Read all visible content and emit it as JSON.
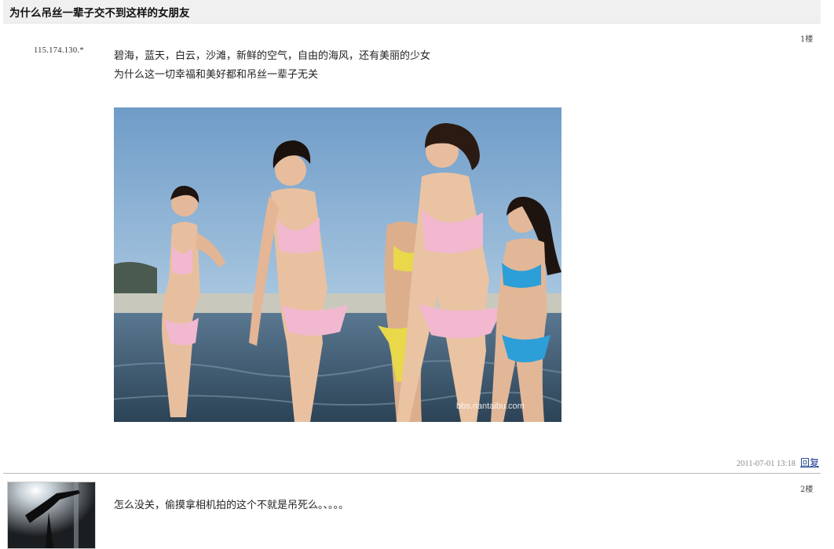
{
  "thread": {
    "title": "为什么吊丝一辈子交不到这样的女朋友"
  },
  "posts": [
    {
      "floor": "1楼",
      "author_ip": "115.174.130.*",
      "lines": [
        "碧海，蓝天，白云，沙滩，新鲜的空气，自由的海风，还有美丽的少女",
        "为什么这一切幸福和美好都和吊丝一辈子无关"
      ],
      "image": {
        "watermark": "bbs.nantaibu.com",
        "sky_color": "#7ea9cf",
        "sea_color": "#42627c",
        "bikini_colors": [
          "#f2b8cf",
          "#e8d84a",
          "#2d9fd8"
        ]
      },
      "timestamp": "2011-07-01 13:18",
      "reply_label": "回复"
    },
    {
      "floor": "2楼",
      "text": "怎么没关，偷摸拿相机拍的这个不就是吊死么。、。。。"
    }
  ]
}
